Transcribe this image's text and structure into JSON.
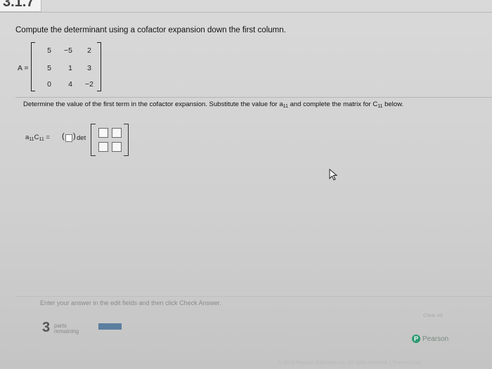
{
  "section_number": "3.1.7",
  "question": "Compute the determinant using a cofactor expansion down the first column.",
  "matrix": {
    "label": "A =",
    "rows": [
      [
        "5",
        "−5",
        "2"
      ],
      [
        "5",
        "1",
        "3"
      ],
      [
        "0",
        "4",
        "−2"
      ]
    ]
  },
  "instruction": {
    "text1": "Determine the value of the first term in the cofactor expansion. Substitute the value for a",
    "sub1": "11",
    "text2": " and complete the matrix for C",
    "sub2": "11",
    "text3": " below."
  },
  "expression": {
    "a": "a",
    "a_sub": "11",
    "c": "C",
    "c_sub": "11",
    "eq": " =",
    "det": "det"
  },
  "footer": {
    "enter_text": "Enter your answer in the edit fields and then click Check Answer.",
    "clear_all": "Clear All",
    "parts_count": "3",
    "parts_label": "parts",
    "parts_remaining": "remaining",
    "brand": "Pearson",
    "copyright": "© 2019 Pearson Education Inc. All rights reserved. | Terms of Use"
  },
  "colors": {
    "progress": "#5b7fa0",
    "brand": "#2f9a73"
  }
}
